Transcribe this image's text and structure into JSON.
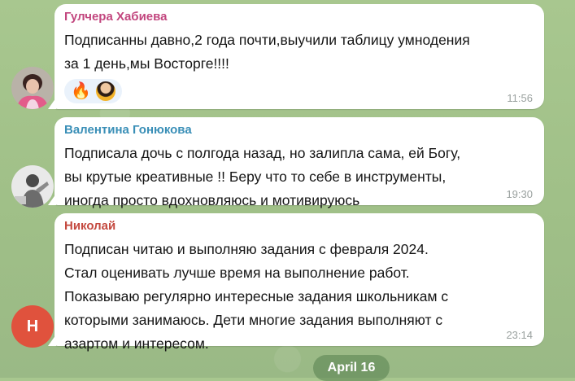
{
  "messages": [
    {
      "author": "Гулчера Хабиева",
      "author_color": "#c2467e",
      "text": "Подписанны давно,2 года почти,выучили таблицу умнодения\nза 1 день,мы Восторге!!!!",
      "time": "11:56",
      "reactions": [
        "fire-emoji",
        "reactor-avatar"
      ]
    },
    {
      "author": "Валентина Гонюкова",
      "author_color": "#3a8fb7",
      "text": "Подписала дочь с полгода назад, но залипла сама, ей Богу,\nвы крутые креативные !! Беру что то себе в инструменты,\nиногда просто вдохновляюсь и мотивируюсь",
      "time": "19:30"
    },
    {
      "author": "Николай",
      "author_color": "#c4493f",
      "avatar_initial": "Н",
      "avatar_color": "#e0523d",
      "text": "Подписан читаю и выполняю задания с февраля 2024.\nСтал оценивать лучше время на выполнение работ.\nПоказываю регулярно интересные задания школьникам  с\nкоторыми занимаюсь. Дети многие задания выполняют   с\nазартом и интересом.",
      "time": "23:14"
    }
  ],
  "date_separator": "April 16"
}
